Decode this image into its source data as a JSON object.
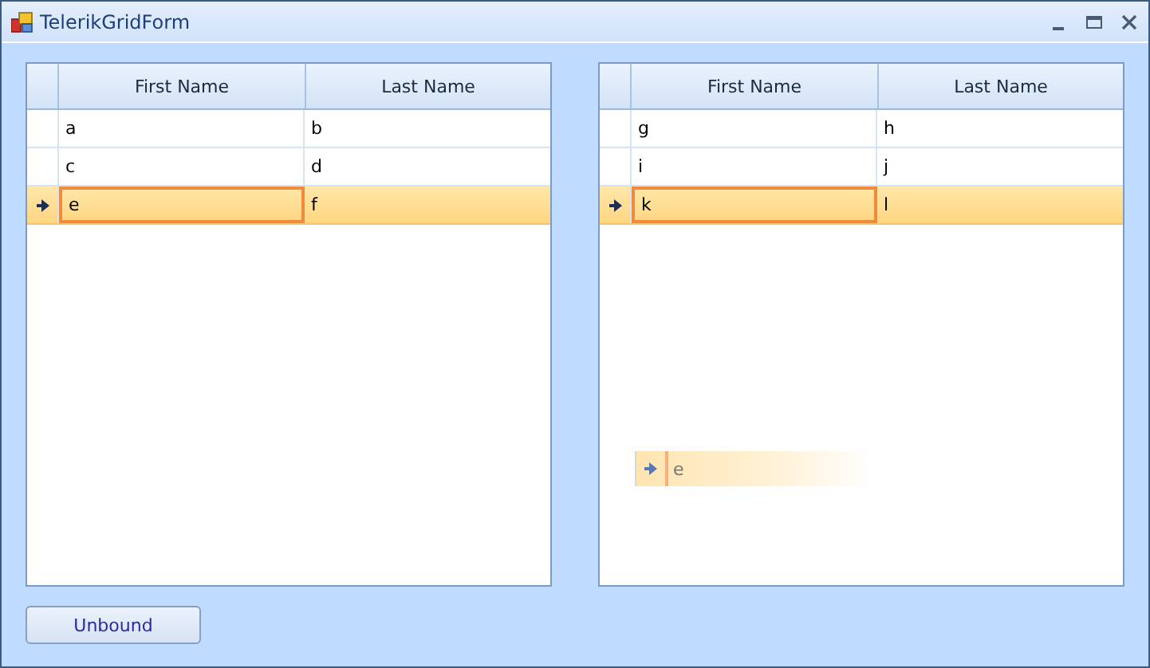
{
  "window": {
    "title": "TelerikGridForm"
  },
  "grids": [
    {
      "columns": [
        "First Name",
        "Last Name"
      ],
      "rows": [
        {
          "selected": false,
          "cells": [
            {
              "text": "a",
              "focused": false
            },
            {
              "text": "b",
              "focused": false
            }
          ]
        },
        {
          "selected": false,
          "cells": [
            {
              "text": "c",
              "focused": false
            },
            {
              "text": "d",
              "focused": false
            }
          ]
        },
        {
          "selected": true,
          "cells": [
            {
              "text": "e",
              "focused": true
            },
            {
              "text": "f",
              "focused": false
            }
          ]
        }
      ]
    },
    {
      "columns": [
        "First Name",
        "Last Name"
      ],
      "rows": [
        {
          "selected": false,
          "cells": [
            {
              "text": "g",
              "focused": false
            },
            {
              "text": "h",
              "focused": false
            }
          ]
        },
        {
          "selected": false,
          "cells": [
            {
              "text": "i",
              "focused": false
            },
            {
              "text": "j",
              "focused": false
            }
          ]
        },
        {
          "selected": true,
          "cells": [
            {
              "text": "k",
              "focused": true
            },
            {
              "text": "l",
              "focused": false
            }
          ]
        }
      ]
    }
  ],
  "drag_preview": {
    "text": "e"
  },
  "buttons": [
    "Unbound"
  ]
}
